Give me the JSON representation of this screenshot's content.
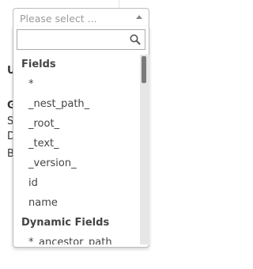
{
  "background": {
    "fragments": [
      "U",
      "G",
      "S",
      "D",
      "B"
    ]
  },
  "select": {
    "placeholder": "Please select ...",
    "icon": "caret-up-icon"
  },
  "search": {
    "value": "",
    "icon": "search-icon"
  },
  "groups": [
    {
      "label": "Fields",
      "options": [
        "*",
        "_nest_path_",
        "_root_",
        "_text_",
        "_version_",
        "id",
        "name"
      ]
    },
    {
      "label": "Dynamic Fields",
      "options": [
        "*_ancestor_path"
      ]
    }
  ],
  "colors": {
    "border": "#bdbdbd",
    "text": "#444444",
    "placeholder": "#9a9a9a",
    "scrollbar_track": "#e6e6e6",
    "scrollbar_thumb": "#7a7a7a"
  }
}
